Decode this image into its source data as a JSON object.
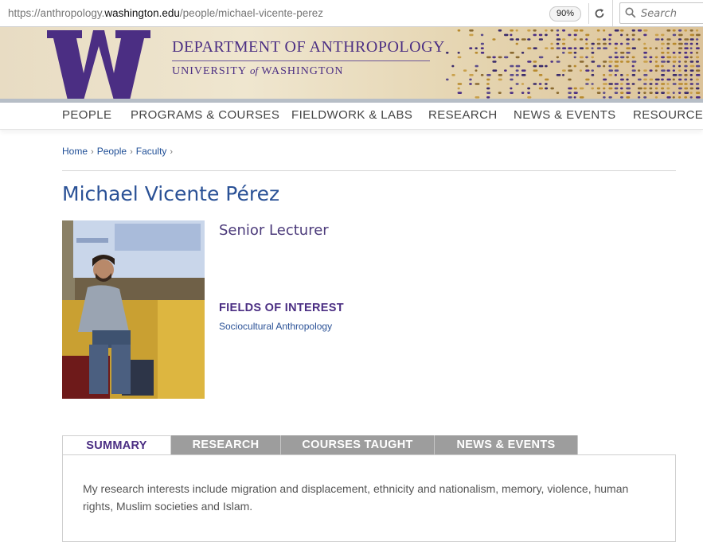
{
  "browser": {
    "url_prefix": "https://anthropology.",
    "url_host": "washington.edu",
    "url_path": "/people/michael-vicente-perez",
    "zoom": "90%",
    "search_placeholder": "Search"
  },
  "banner": {
    "department": "DEPARTMENT OF ANTHROPOLOGY",
    "university_pre": "UNIVERSITY",
    "university_of": "of",
    "university_post": "WASHINGTON",
    "brand_color": "#4b2e83"
  },
  "nav": {
    "items": [
      "PEOPLE",
      "PROGRAMS & COURSES",
      "FIELDWORK & LABS",
      "RESEARCH",
      "NEWS & EVENTS",
      "RESOURCES"
    ]
  },
  "breadcrumb": [
    "Home",
    "People",
    "Faculty"
  ],
  "profile": {
    "name": "Michael Vicente Pérez",
    "title": "Senior Lecturer",
    "fields_heading": "FIELDS OF INTEREST",
    "fields": "Sociocultural Anthropology"
  },
  "tabs": {
    "items": [
      "SUMMARY",
      "RESEARCH",
      "COURSES TAUGHT",
      "NEWS & EVENTS"
    ],
    "active": "SUMMARY"
  },
  "summary": {
    "text": "My research interests include migration and displacement, ethnicity and nationalism, memory, violence, human rights, Muslim societies and Islam."
  }
}
